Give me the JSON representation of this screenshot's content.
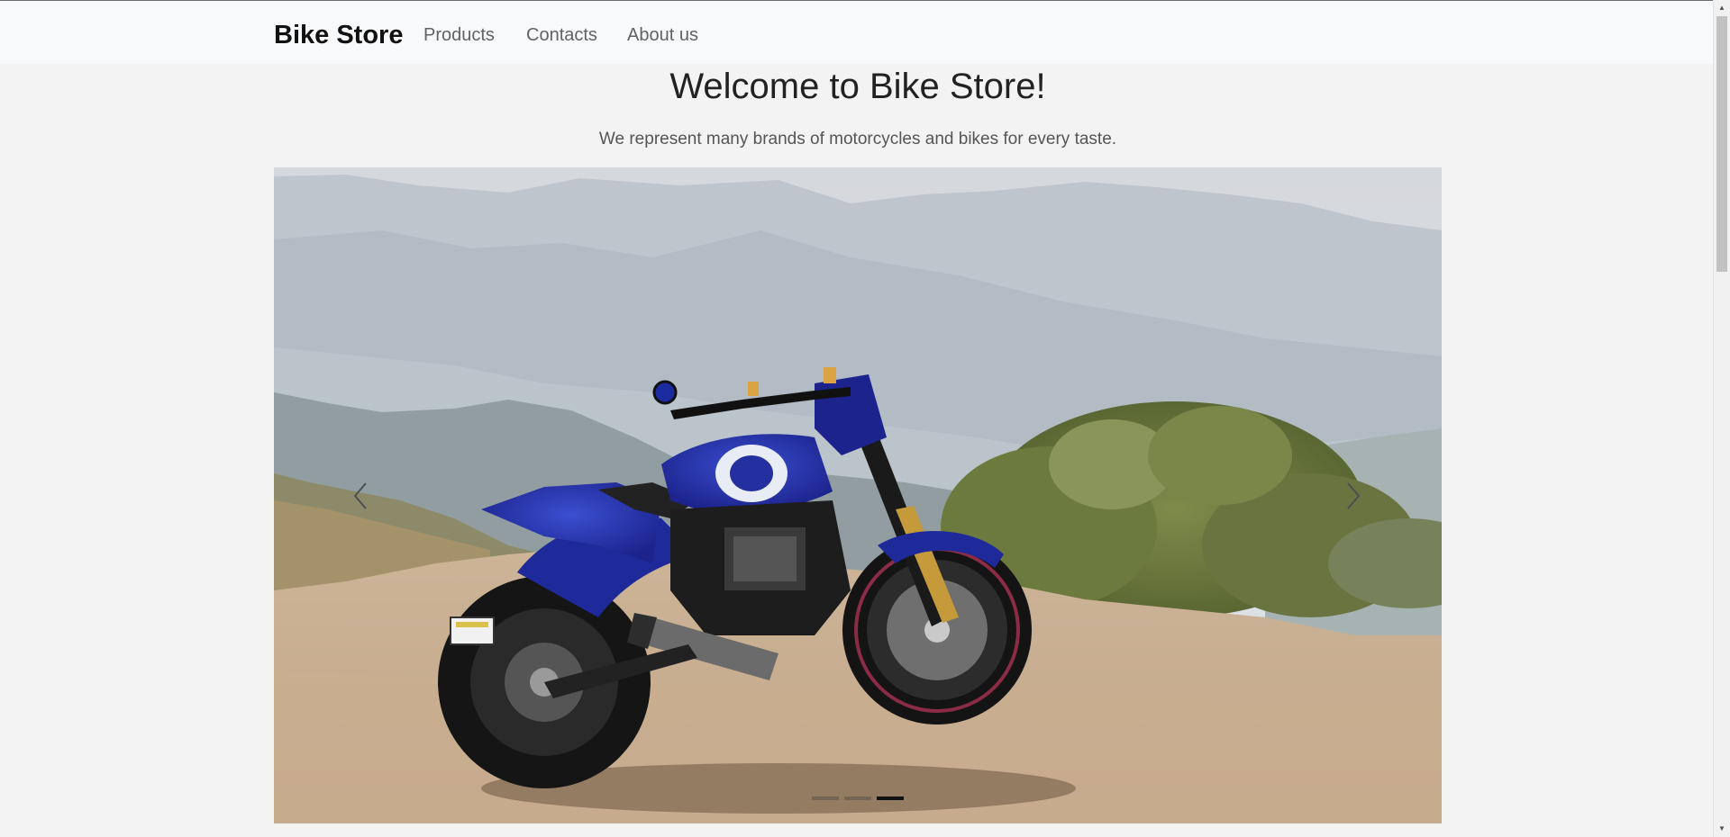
{
  "navbar": {
    "brand": "Bike Store",
    "links": [
      "Products",
      "Contacts",
      "About us"
    ]
  },
  "hero": {
    "title": "Welcome to Bike Store!",
    "subtitle": "We represent many brands of motorcycles and bikes for every taste."
  },
  "carousel": {
    "slide_image": "blue-custom-motorcycle-on-dirt-hill",
    "prev_icon": "chevron-left-icon",
    "next_icon": "chevron-right-icon",
    "active_slide_index": 2,
    "slide_count": 3
  },
  "colors": {
    "navbar_bg": "#f8f9fa",
    "page_bg": "#f3f3f3",
    "brand": "#111111",
    "nav_link": "#5f6366"
  }
}
